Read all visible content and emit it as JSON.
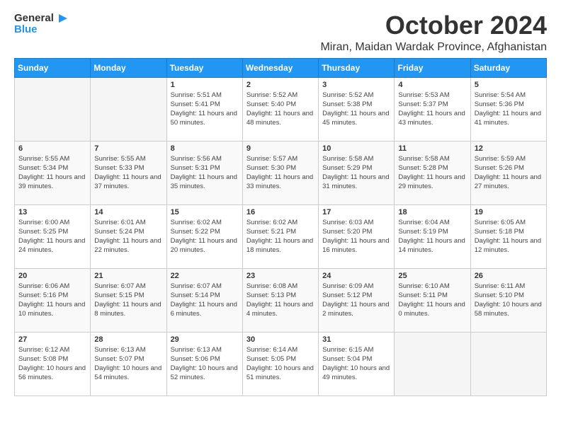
{
  "logo": {
    "general": "General",
    "blue": "Blue"
  },
  "header": {
    "month": "October 2024",
    "location": "Miran, Maidan Wardak Province, Afghanistan"
  },
  "weekdays": [
    "Sunday",
    "Monday",
    "Tuesday",
    "Wednesday",
    "Thursday",
    "Friday",
    "Saturday"
  ],
  "weeks": [
    [
      {
        "day": null,
        "info": ""
      },
      {
        "day": null,
        "info": ""
      },
      {
        "day": "1",
        "info": "Sunrise: 5:51 AM\nSunset: 5:41 PM\nDaylight: 11 hours and 50 minutes."
      },
      {
        "day": "2",
        "info": "Sunrise: 5:52 AM\nSunset: 5:40 PM\nDaylight: 11 hours and 48 minutes."
      },
      {
        "day": "3",
        "info": "Sunrise: 5:52 AM\nSunset: 5:38 PM\nDaylight: 11 hours and 45 minutes."
      },
      {
        "day": "4",
        "info": "Sunrise: 5:53 AM\nSunset: 5:37 PM\nDaylight: 11 hours and 43 minutes."
      },
      {
        "day": "5",
        "info": "Sunrise: 5:54 AM\nSunset: 5:36 PM\nDaylight: 11 hours and 41 minutes."
      }
    ],
    [
      {
        "day": "6",
        "info": "Sunrise: 5:55 AM\nSunset: 5:34 PM\nDaylight: 11 hours and 39 minutes."
      },
      {
        "day": "7",
        "info": "Sunrise: 5:55 AM\nSunset: 5:33 PM\nDaylight: 11 hours and 37 minutes."
      },
      {
        "day": "8",
        "info": "Sunrise: 5:56 AM\nSunset: 5:31 PM\nDaylight: 11 hours and 35 minutes."
      },
      {
        "day": "9",
        "info": "Sunrise: 5:57 AM\nSunset: 5:30 PM\nDaylight: 11 hours and 33 minutes."
      },
      {
        "day": "10",
        "info": "Sunrise: 5:58 AM\nSunset: 5:29 PM\nDaylight: 11 hours and 31 minutes."
      },
      {
        "day": "11",
        "info": "Sunrise: 5:58 AM\nSunset: 5:28 PM\nDaylight: 11 hours and 29 minutes."
      },
      {
        "day": "12",
        "info": "Sunrise: 5:59 AM\nSunset: 5:26 PM\nDaylight: 11 hours and 27 minutes."
      }
    ],
    [
      {
        "day": "13",
        "info": "Sunrise: 6:00 AM\nSunset: 5:25 PM\nDaylight: 11 hours and 24 minutes."
      },
      {
        "day": "14",
        "info": "Sunrise: 6:01 AM\nSunset: 5:24 PM\nDaylight: 11 hours and 22 minutes."
      },
      {
        "day": "15",
        "info": "Sunrise: 6:02 AM\nSunset: 5:22 PM\nDaylight: 11 hours and 20 minutes."
      },
      {
        "day": "16",
        "info": "Sunrise: 6:02 AM\nSunset: 5:21 PM\nDaylight: 11 hours and 18 minutes."
      },
      {
        "day": "17",
        "info": "Sunrise: 6:03 AM\nSunset: 5:20 PM\nDaylight: 11 hours and 16 minutes."
      },
      {
        "day": "18",
        "info": "Sunrise: 6:04 AM\nSunset: 5:19 PM\nDaylight: 11 hours and 14 minutes."
      },
      {
        "day": "19",
        "info": "Sunrise: 6:05 AM\nSunset: 5:18 PM\nDaylight: 11 hours and 12 minutes."
      }
    ],
    [
      {
        "day": "20",
        "info": "Sunrise: 6:06 AM\nSunset: 5:16 PM\nDaylight: 11 hours and 10 minutes."
      },
      {
        "day": "21",
        "info": "Sunrise: 6:07 AM\nSunset: 5:15 PM\nDaylight: 11 hours and 8 minutes."
      },
      {
        "day": "22",
        "info": "Sunrise: 6:07 AM\nSunset: 5:14 PM\nDaylight: 11 hours and 6 minutes."
      },
      {
        "day": "23",
        "info": "Sunrise: 6:08 AM\nSunset: 5:13 PM\nDaylight: 11 hours and 4 minutes."
      },
      {
        "day": "24",
        "info": "Sunrise: 6:09 AM\nSunset: 5:12 PM\nDaylight: 11 hours and 2 minutes."
      },
      {
        "day": "25",
        "info": "Sunrise: 6:10 AM\nSunset: 5:11 PM\nDaylight: 11 hours and 0 minutes."
      },
      {
        "day": "26",
        "info": "Sunrise: 6:11 AM\nSunset: 5:10 PM\nDaylight: 10 hours and 58 minutes."
      }
    ],
    [
      {
        "day": "27",
        "info": "Sunrise: 6:12 AM\nSunset: 5:08 PM\nDaylight: 10 hours and 56 minutes."
      },
      {
        "day": "28",
        "info": "Sunrise: 6:13 AM\nSunset: 5:07 PM\nDaylight: 10 hours and 54 minutes."
      },
      {
        "day": "29",
        "info": "Sunrise: 6:13 AM\nSunset: 5:06 PM\nDaylight: 10 hours and 52 minutes."
      },
      {
        "day": "30",
        "info": "Sunrise: 6:14 AM\nSunset: 5:05 PM\nDaylight: 10 hours and 51 minutes."
      },
      {
        "day": "31",
        "info": "Sunrise: 6:15 AM\nSunset: 5:04 PM\nDaylight: 10 hours and 49 minutes."
      },
      {
        "day": null,
        "info": ""
      },
      {
        "day": null,
        "info": ""
      }
    ]
  ]
}
